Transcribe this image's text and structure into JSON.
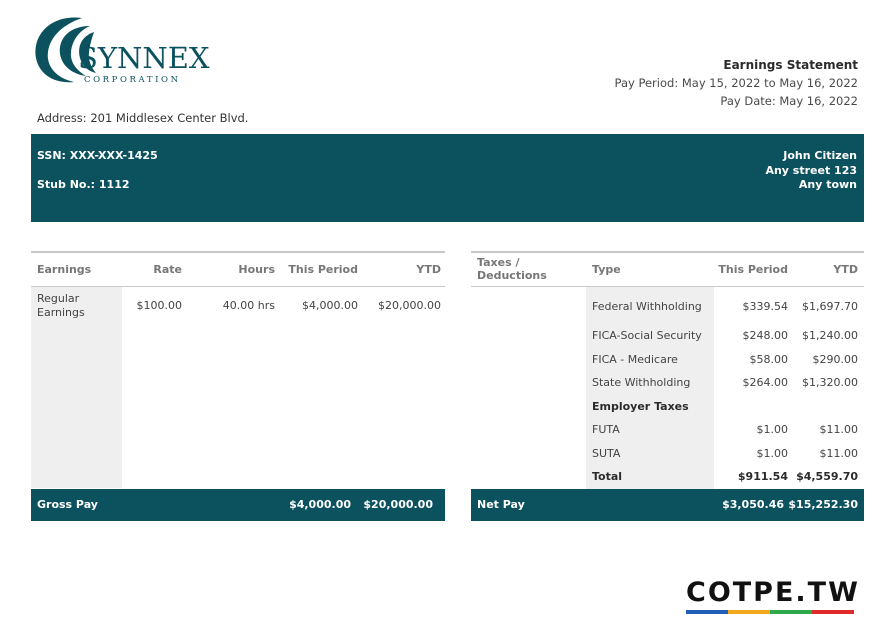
{
  "company": {
    "name": "SYNNEX",
    "subtitle": "CORPORATION"
  },
  "statement": {
    "title": "Earnings Statement",
    "pay_period": "Pay Period: May 15, 2022 to May 16, 2022",
    "pay_date": "Pay Date: May 16, 2022"
  },
  "address": "Address:  201 Middlesex Center Blvd.",
  "employee": {
    "ssn": "SSN: XXX-XXX-1425",
    "stub": "Stub No.: 1112",
    "name": "John Citizen",
    "street": "Any street 123",
    "town": "Any town"
  },
  "earnings": {
    "headers": [
      "Earnings",
      "Rate",
      "Hours",
      "This Period",
      "YTD"
    ],
    "rows": [
      {
        "name_line1": "Regular",
        "name_line2": "Earnings",
        "rate": "$100.00",
        "hours": "40.00 hrs",
        "period": "$4,000.00",
        "ytd": "$20,000.00"
      }
    ],
    "gross": {
      "label": "Gross Pay",
      "period": "$4,000.00",
      "ytd": "$20,000.00"
    }
  },
  "taxes": {
    "headers": [
      "Taxes / Deductions",
      "Type",
      "This Period",
      "YTD"
    ],
    "rows": [
      {
        "type": "Federal Withholding",
        "period": "$339.54",
        "ytd": "$1,697.70"
      },
      {
        "type": "FICA-Social Security",
        "period": "$248.00",
        "ytd": "$1,240.00"
      },
      {
        "type": "FICA - Medicare",
        "period": "$58.00",
        "ytd": "$290.00"
      },
      {
        "type": "State Withholding",
        "period": "$264.00",
        "ytd": "$1,320.00"
      },
      {
        "type": "Employer Taxes",
        "period": "",
        "ytd": ""
      },
      {
        "type": "FUTA",
        "period": "$1.00",
        "ytd": "$11.00"
      },
      {
        "type": "SUTA",
        "period": "$1.00",
        "ytd": "$11.00"
      },
      {
        "type": "Total",
        "period": "$911.54",
        "ytd": "$4,559.70"
      }
    ],
    "net": {
      "label": "Net Pay",
      "period": "$3,050.46",
      "ytd": "$15,252.30"
    }
  },
  "watermark": {
    "text": "COTPE.TW",
    "colors": [
      "#1f5fb8",
      "#f2a81d",
      "#2ea84a",
      "#e02a2a"
    ]
  },
  "colors": {
    "band": "#0c525e"
  }
}
